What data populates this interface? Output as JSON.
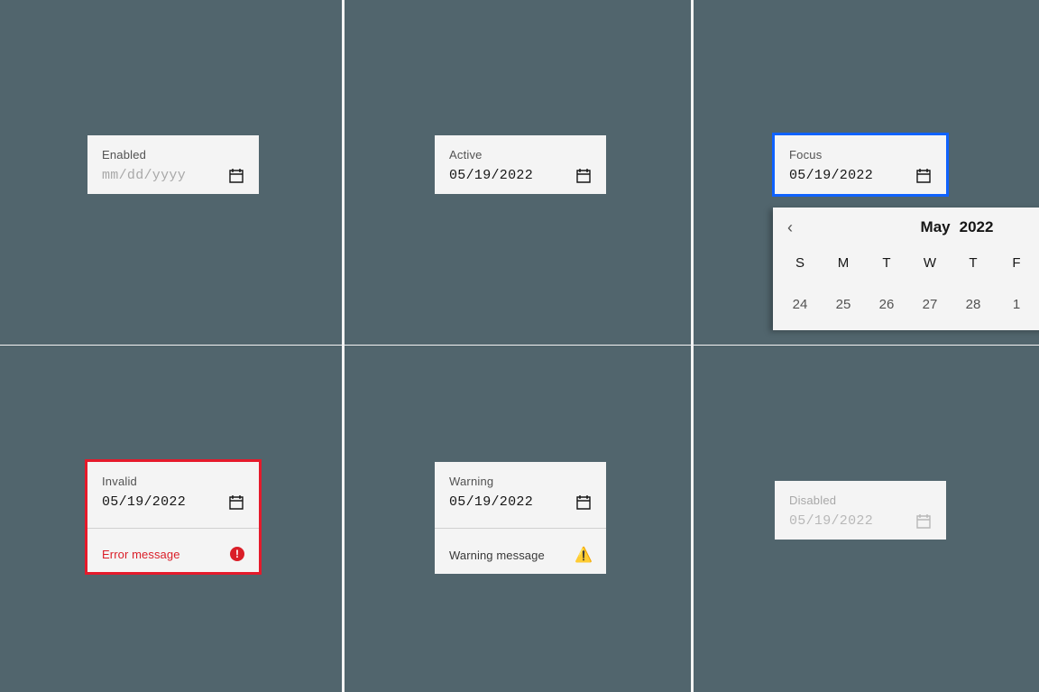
{
  "states": {
    "enabled": {
      "label": "Enabled",
      "value": "mm/dd/yyyy"
    },
    "active": {
      "label": "Active",
      "value": "05/19/2022"
    },
    "focus": {
      "label": "Focus",
      "value": "05/19/2022"
    },
    "invalid": {
      "label": "Invalid",
      "value": "05/19/2022",
      "message": "Error message"
    },
    "warning": {
      "label": "Warning",
      "value": "05/19/2022",
      "message": "Warning message"
    },
    "disabled": {
      "label": "Disabled",
      "value": "05/19/2022"
    }
  },
  "calendar": {
    "month": "May",
    "year": "2022",
    "weekdays": [
      "S",
      "M",
      "T",
      "W",
      "T",
      "F"
    ],
    "prev_month_dates": [
      "24",
      "25",
      "26",
      "27",
      "28",
      "1"
    ]
  },
  "colors": {
    "background": "#51656d",
    "surface": "#f4f4f4",
    "focus": "#0f62fe",
    "error": "#da1e28"
  },
  "icons": {
    "calendar": "calendar-icon",
    "chevron_left": "chevron-left-icon",
    "error": "error-filled-icon",
    "warning": "warning-icon"
  }
}
